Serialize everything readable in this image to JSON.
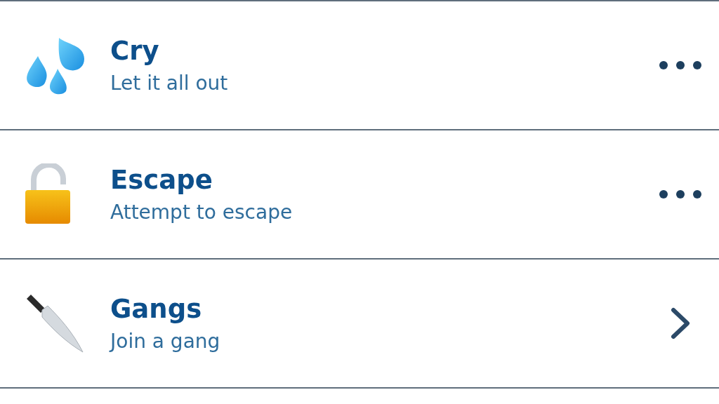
{
  "rows": [
    {
      "title": "Cry",
      "subtitle": "Let it all out",
      "kind": "more"
    },
    {
      "title": "Escape",
      "subtitle": "Attempt to escape",
      "kind": "more"
    },
    {
      "title": "Gangs",
      "subtitle": "Join a gang",
      "kind": "chevron"
    }
  ]
}
